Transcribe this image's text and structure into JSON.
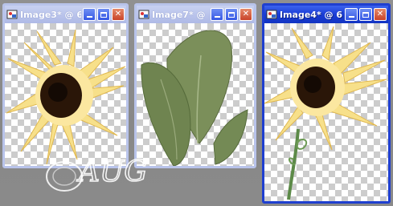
{
  "windows": [
    {
      "title": "Image3* @ 6...",
      "active": false,
      "content": "sunflower-head"
    },
    {
      "title": "Image7* @ ...",
      "active": false,
      "content": "green-leaves"
    },
    {
      "title": "Image4* @ 6...",
      "active": true,
      "content": "sunflower-with-stem"
    }
  ],
  "controls": {
    "minimize_icon": "minimize-icon",
    "maximize_icon": "maximize-icon",
    "close_icon": "close-icon",
    "close_glyph": "✕"
  },
  "colors": {
    "active_titlebar": "#1f3fd0",
    "inactive_titlebar": "#b8c3ea",
    "petal": "#f7e08a",
    "center": "#2a1608",
    "leaf": "#7b8f5a"
  },
  "watermark": {
    "text": "AUG"
  }
}
